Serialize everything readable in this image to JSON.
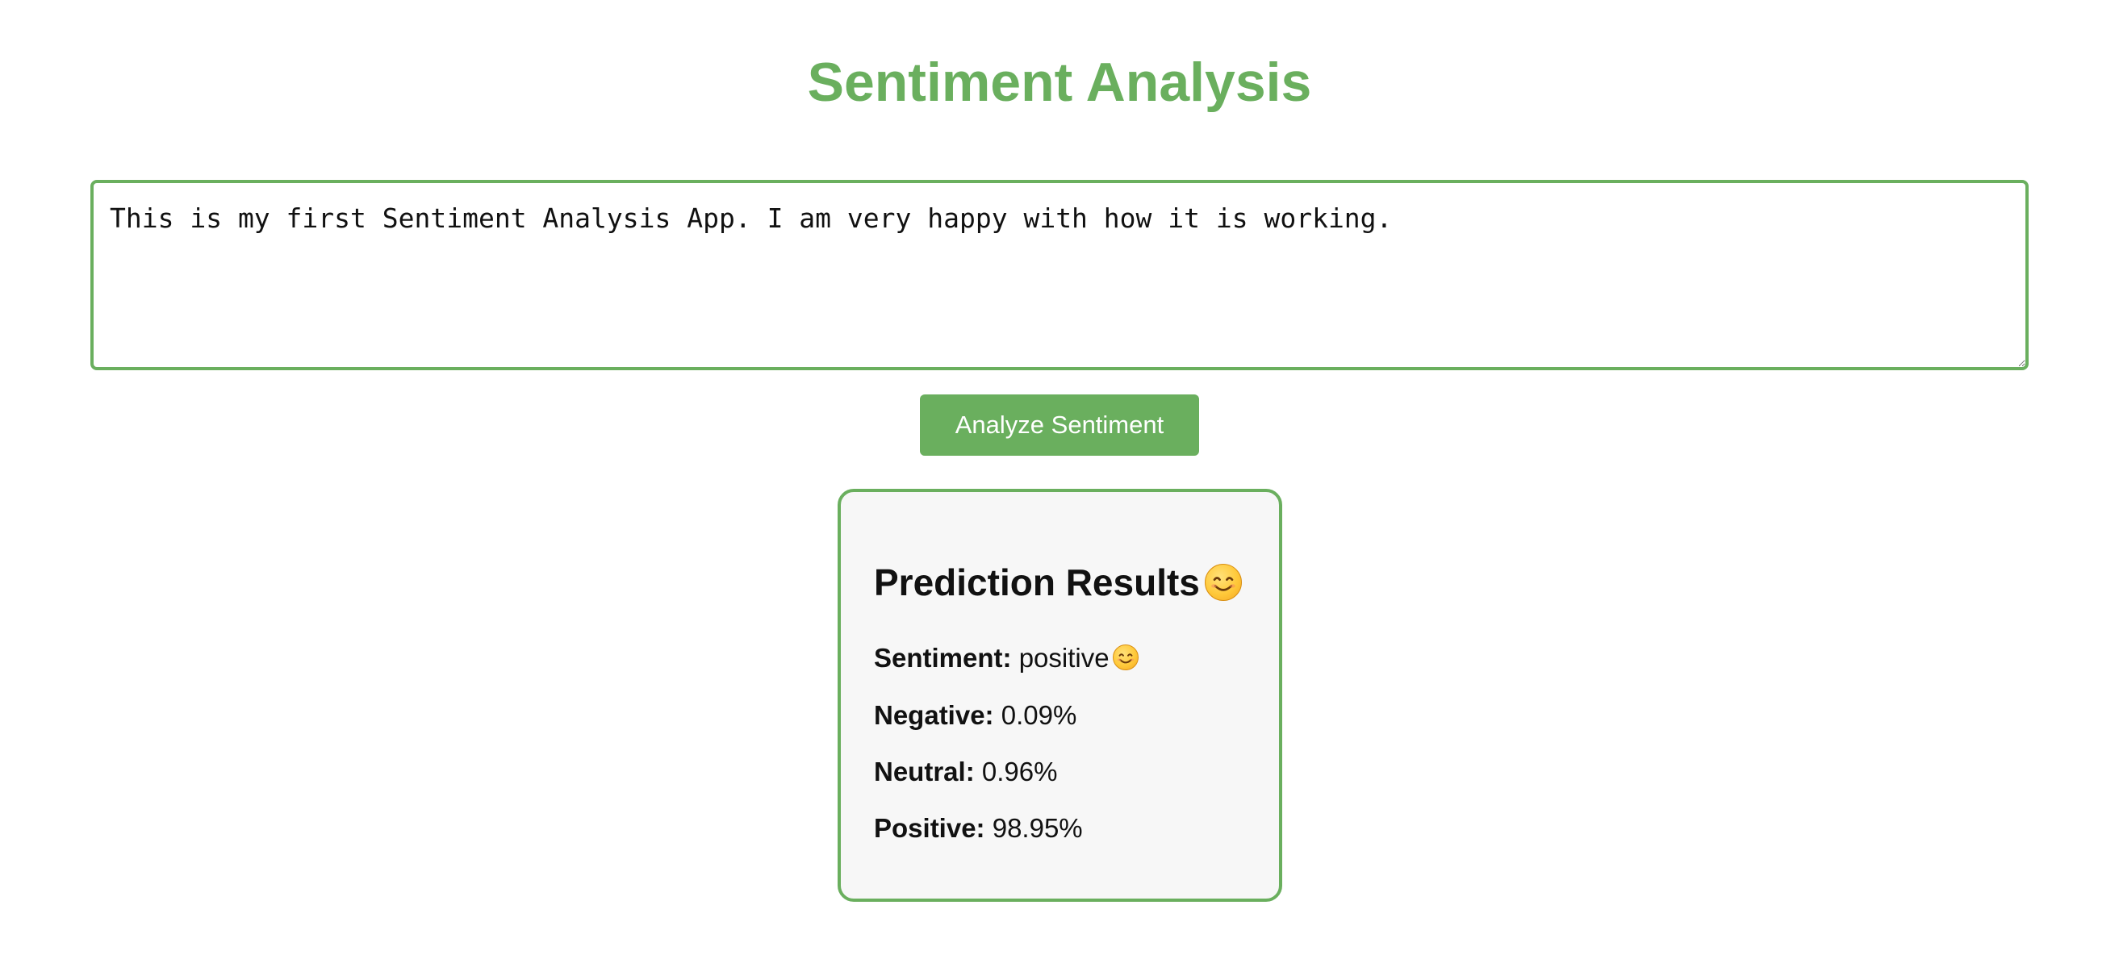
{
  "header": {
    "title": "Sentiment Analysis"
  },
  "input": {
    "value": "This is my first Sentiment Analysis App. I am very happy with how it is working."
  },
  "actions": {
    "analyze_label": "Analyze Sentiment"
  },
  "results": {
    "heading": "Prediction Results",
    "heading_icon": "smiling-face-icon",
    "rows": [
      {
        "label": "Sentiment:",
        "value": "positive",
        "icon": "smiling-face-icon"
      },
      {
        "label": "Negative:",
        "value": "0.09%"
      },
      {
        "label": "Neutral:",
        "value": "0.96%"
      },
      {
        "label": "Positive:",
        "value": "98.95%"
      }
    ]
  },
  "colors": {
    "accent": "#6aaf5e",
    "card_background": "#f7f7f7",
    "text": "#111111"
  }
}
